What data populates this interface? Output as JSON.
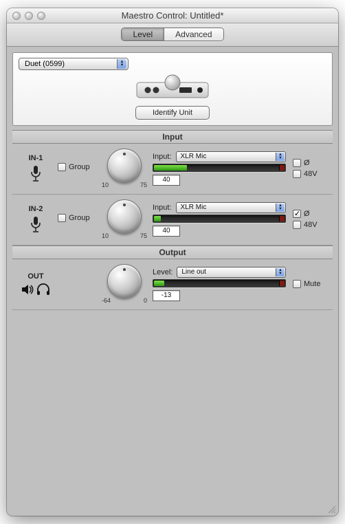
{
  "window": {
    "title": "Maestro Control: Untitled*"
  },
  "tabs": {
    "level": "Level",
    "advanced": "Advanced",
    "selected": "level"
  },
  "unit": {
    "device_popup": "Duet (0599)",
    "identify_button": "Identify Unit"
  },
  "sections": {
    "input_header": "Input",
    "output_header": "Output"
  },
  "inputs": [
    {
      "name": "IN-1",
      "group_label": "Group",
      "group_checked": false,
      "knob_min": "10",
      "knob_max": "75",
      "source_label": "Input:",
      "source_value": "XLR Mic",
      "meter_fill_pct": 25,
      "value": "40",
      "phase_label": "Ø",
      "phase_checked": false,
      "phantom_label": "48V",
      "phantom_checked": false
    },
    {
      "name": "IN-2",
      "group_label": "Group",
      "group_checked": false,
      "knob_min": "10",
      "knob_max": "75",
      "source_label": "Input:",
      "source_value": "XLR Mic",
      "meter_fill_pct": 5,
      "value": "40",
      "phase_label": "Ø",
      "phase_checked": true,
      "phantom_label": "48V",
      "phantom_checked": false
    }
  ],
  "output": {
    "name": "OUT",
    "knob_min": "-64",
    "knob_max": "0",
    "level_label": "Level:",
    "dest_value": "Line out",
    "meter_fill_pct": 8,
    "value": "-13",
    "mute_label": "Mute",
    "mute_checked": false
  }
}
